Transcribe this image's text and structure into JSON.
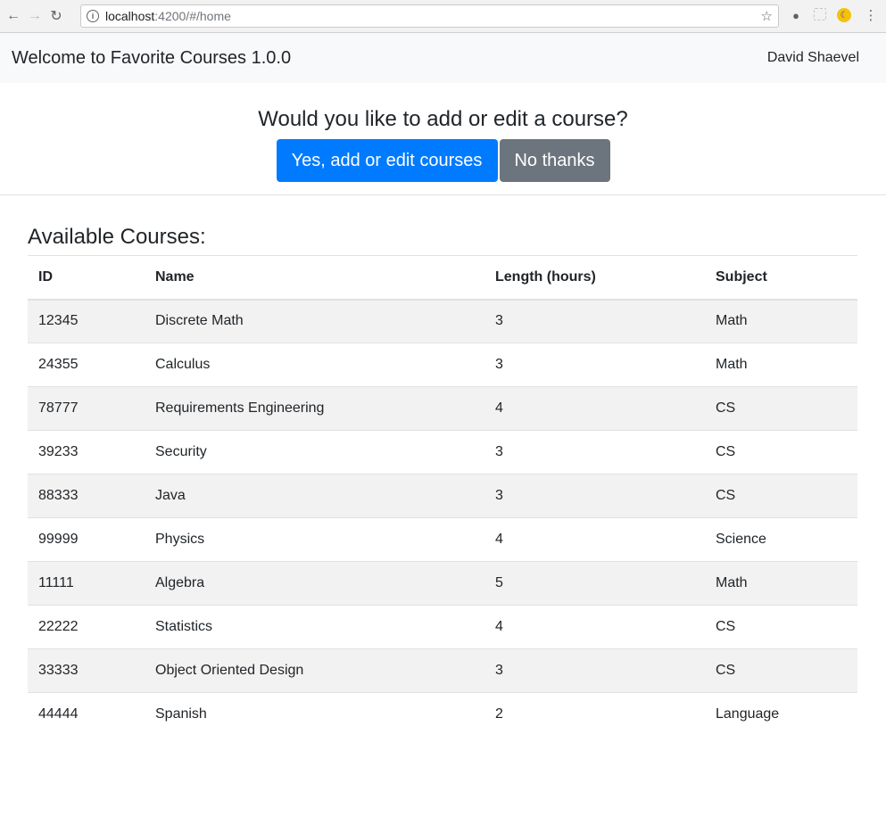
{
  "browser": {
    "url_host": "localhost",
    "url_path": ":4200/#/home"
  },
  "navbar": {
    "brand": "Welcome to Favorite Courses 1.0.0",
    "user": "David Shaevel"
  },
  "prompt": {
    "question": "Would you like to add or edit a course?",
    "yes_label": "Yes, add or edit courses",
    "no_label": "No thanks"
  },
  "courses": {
    "heading": "Available Courses:",
    "columns": [
      "ID",
      "Name",
      "Length (hours)",
      "Subject"
    ],
    "rows": [
      [
        "12345",
        "Discrete Math",
        "3",
        "Math"
      ],
      [
        "24355",
        "Calculus",
        "3",
        "Math"
      ],
      [
        "78777",
        "Requirements Engineering",
        "4",
        "CS"
      ],
      [
        "39233",
        "Security",
        "3",
        "CS"
      ],
      [
        "88333",
        "Java",
        "3",
        "CS"
      ],
      [
        "99999",
        "Physics",
        "4",
        "Science"
      ],
      [
        "11111",
        "Algebra",
        "5",
        "Math"
      ],
      [
        "22222",
        "Statistics",
        "4",
        "CS"
      ],
      [
        "33333",
        "Object Oriented Design",
        "3",
        "CS"
      ],
      [
        "44444",
        "Spanish",
        "2",
        "Language"
      ]
    ]
  },
  "colors": {
    "primary": "#007bff",
    "secondary": "#6c757d",
    "navbar_bg": "#f8f9fa",
    "stripe": "#f2f2f2"
  }
}
